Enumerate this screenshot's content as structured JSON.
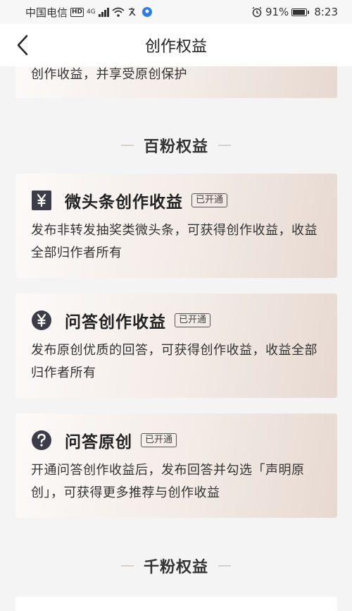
{
  "status_bar": {
    "carrier": "中国电信",
    "hd": "HD",
    "network": "4G",
    "battery_percent": "91%",
    "battery_level": 0.91,
    "time": "8:23"
  },
  "nav": {
    "title": "创作权益"
  },
  "top_card": {
    "desc": "创作收益，并享受原创保护"
  },
  "section_baifen": {
    "title": "百粉权益"
  },
  "benefits": [
    {
      "icon": "yen-square-icon",
      "title": "微头条创作收益",
      "badge": "已开通",
      "desc": "发布非转发抽奖类微头条，可获得创作收益，收益全部归作者所有"
    },
    {
      "icon": "yen-circle-icon",
      "title": "问答创作收益",
      "badge": "已开通",
      "desc": "发布原创优质的回答，可获得创作收益，收益全部归作者所有"
    },
    {
      "icon": "question-circle-icon",
      "title": "问答原创",
      "badge": "已开通",
      "desc": "开通问答创作收益后，发布回答并勾选「声明原创」，可获得更多推荐与创作收益"
    }
  ],
  "section_qianfen": {
    "title": "千粉权益"
  },
  "colors": {
    "card_start": "#fcfaf9",
    "card_end": "#e7d9d1",
    "icon_dark": "#3d3d4a"
  }
}
